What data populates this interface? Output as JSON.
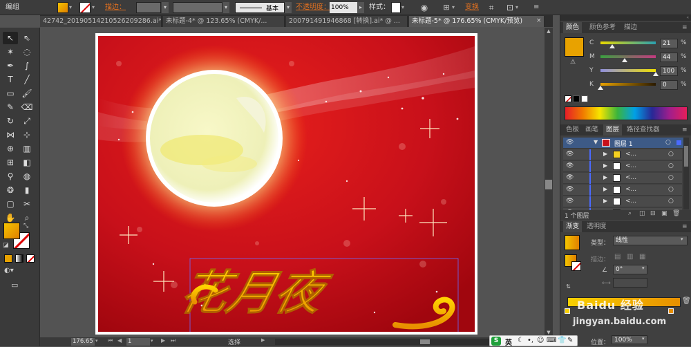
{
  "control_bar": {
    "selection_label": "编组",
    "stroke_label": "描边：",
    "stroke_style_label": "基本",
    "opacity_label": "不透明度：",
    "opacity_value": "100%",
    "style_label": "样式：",
    "transform_label": "变换"
  },
  "doc_tabs": [
    {
      "label": "42742_20190514210526209286.ai*"
    },
    {
      "label": "未标题-4* @ 123.65% (CMYK/..."
    },
    {
      "label": "200791491946868 [转换].ai* @ ..."
    },
    {
      "label": "未标题-5* @ 176.65% (CMYK/预览)"
    }
  ],
  "artwork": {
    "calligraphy_text": "花月夜"
  },
  "color_panel": {
    "tabs": [
      "颜色",
      "颜色参考",
      "描边"
    ],
    "channels": [
      {
        "label": "C",
        "value": "21",
        "unit": "%",
        "fraction": 0.21
      },
      {
        "label": "M",
        "value": "44",
        "unit": "%",
        "fraction": 0.44
      },
      {
        "label": "Y",
        "value": "100",
        "unit": "%",
        "fraction": 1.0
      },
      {
        "label": "K",
        "value": "0",
        "unit": "%",
        "fraction": 0.0
      }
    ]
  },
  "layers_panel": {
    "tabs": [
      "色板",
      "画笔",
      "图层",
      "路径查找器"
    ],
    "layer_name": "图层 1",
    "sublayers": [
      {
        "label": "<..."
      },
      {
        "label": "<..."
      },
      {
        "label": "<..."
      },
      {
        "label": "<..."
      },
      {
        "label": "<..."
      },
      {
        "label": "<..."
      }
    ],
    "footer_label": "1 个图层"
  },
  "gradient_panel": {
    "tabs": [
      "渐变",
      "透明度"
    ],
    "type_label": "类型：",
    "type_value": "线性",
    "stroke_label": "描边：",
    "angle_value": "0°",
    "location_label": "位置：",
    "location_value": "100%"
  },
  "status_bar": {
    "zoom": "176.65",
    "page": "1",
    "tool_label": "选择"
  },
  "overlays": {
    "watermark": "Baidu 经验",
    "watermark_url": "jingyan.baidu.com",
    "ime_label": "英"
  },
  "colors": {
    "fill": "#e8a200",
    "art_red": "#c8101a",
    "accent_orange": "#e07020"
  }
}
